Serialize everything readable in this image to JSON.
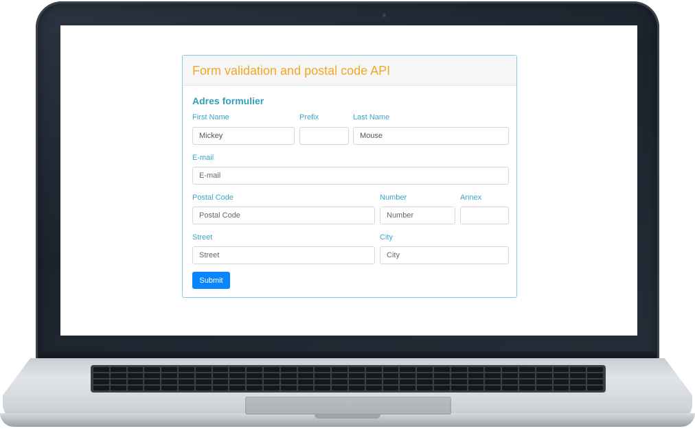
{
  "form": {
    "title": "Form validation and postal code API",
    "section_title": "Adres formulier",
    "fields": {
      "first_name": {
        "label": "First Name",
        "value": "Mickey",
        "placeholder": ""
      },
      "prefix": {
        "label": "Prefix",
        "value": "",
        "placeholder": ""
      },
      "last_name": {
        "label": "Last Name",
        "value": "Mouse",
        "placeholder": ""
      },
      "email": {
        "label": "E-mail",
        "value": "",
        "placeholder": "E-mail"
      },
      "postal_code": {
        "label": "Postal Code",
        "value": "",
        "placeholder": "Postal Code"
      },
      "number": {
        "label": "Number",
        "value": "",
        "placeholder": "Number"
      },
      "annex": {
        "label": "Annex",
        "value": "",
        "placeholder": ""
      },
      "street": {
        "label": "Street",
        "value": "",
        "placeholder": "Street"
      },
      "city": {
        "label": "City",
        "value": "",
        "placeholder": "City"
      }
    },
    "submit_label": "Submit"
  },
  "colors": {
    "title": "#f5a623",
    "label": "#3aa6c6",
    "button": "#0a84ff",
    "card_border": "#7fcbe0"
  }
}
